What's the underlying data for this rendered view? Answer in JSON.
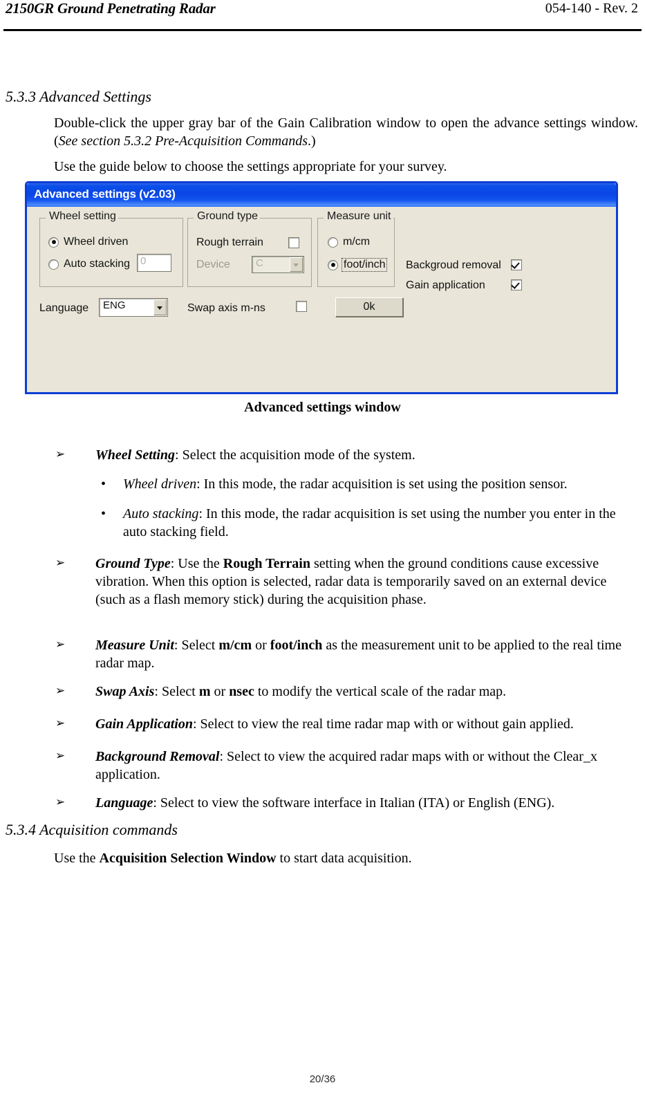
{
  "header": {
    "left_title": "2150GR Ground Penetrating Radar",
    "right_doc": "054-140 - Rev. 2"
  },
  "sections": {
    "s533_heading": "5.3.3 Advanced Settings",
    "s534_heading": "5.3.4 Acquisition commands"
  },
  "paragraphs": {
    "intro_a": "Double-click the upper gray bar of the Gain Calibration window to open the advance settings window. (",
    "intro_b_italic": "See section 5.3.2 Pre-Acquisition Commands",
    "intro_c": ".)",
    "guide": "Use the guide below to choose the settings appropriate for your survey.",
    "acq_a": "Use the ",
    "acq_b_bold": "Acquisition Selection Window",
    "acq_c": " to start data acquisition."
  },
  "figure": {
    "caption": "Advanced settings window",
    "dialog": {
      "title": "Advanced settings (v2.03)",
      "groups": {
        "wheel": {
          "legend": "Wheel setting",
          "options": [
            {
              "label": "Wheel driven",
              "selected": true
            },
            {
              "label": "Auto stacking",
              "selected": false
            }
          ],
          "stack_value": "0"
        },
        "ground": {
          "legend": "Ground type",
          "rough_terrain_label": "Rough terrain",
          "rough_terrain_checked": false,
          "device_label": "Device",
          "device_value": "C",
          "device_disabled": true
        },
        "unit": {
          "legend": "Measure unit",
          "options": [
            {
              "label": "m/cm",
              "selected": false
            },
            {
              "label": "foot/inch",
              "selected": true
            }
          ]
        }
      },
      "checks": [
        {
          "label": "Backgroud removal",
          "checked": true
        },
        {
          "label": "Gain application",
          "checked": true
        }
      ],
      "language_label": "Language",
      "language_value": "ENG",
      "swap_axis_label": "Swap axis m-ns",
      "swap_axis_checked": false,
      "ok_label": "0k"
    }
  },
  "bullets": [
    {
      "marker": "➢",
      "term": "Wheel Setting",
      "rest": ": Select the acquisition mode of the system."
    },
    {
      "marker": "➢",
      "term": "Ground Type",
      "rest": ": Use the ",
      "emph": "Rough Terrain",
      "tail": " setting when the ground conditions cause excessive vibration. When this option is selected, radar data is temporarily saved on an external device (such as a flash memory stick) during the acquisition phase."
    },
    {
      "marker": "➢",
      "term": "Measure Unit",
      "rest": ": Select ",
      "emph": "m/cm",
      "mid": " or ",
      "emph2": "foot/inch",
      "tail": " as the measurement unit to be applied to the real time radar map."
    },
    {
      "marker": "➢",
      "term": "Swap Axis",
      "rest": ": Select ",
      "emph": "m",
      "mid": " or ",
      "emph2": "nsec",
      "tail": " to modify the vertical scale of the radar map."
    },
    {
      "marker": "➢",
      "term": "Gain Application",
      "rest": ": Select to view the real time radar map with or without gain applied."
    },
    {
      "marker": "➢",
      "term": "Background Removal",
      "rest": ": Select to view the acquired radar maps with or without the Clear_x application."
    },
    {
      "marker": "➢",
      "term": "Language",
      "rest": ": Select to view the software interface in Italian (ITA) or English (ENG)."
    }
  ],
  "subbullets": [
    {
      "marker": "•",
      "term": "Wheel driven",
      "rest": ": In this mode, the radar acquisition is set using the position sensor."
    },
    {
      "marker": "•",
      "term": "Auto stacking",
      "rest": ": In this mode, the radar acquisition is set using the number you enter in the auto stacking field."
    }
  ],
  "footer": {
    "page": "20/36"
  }
}
